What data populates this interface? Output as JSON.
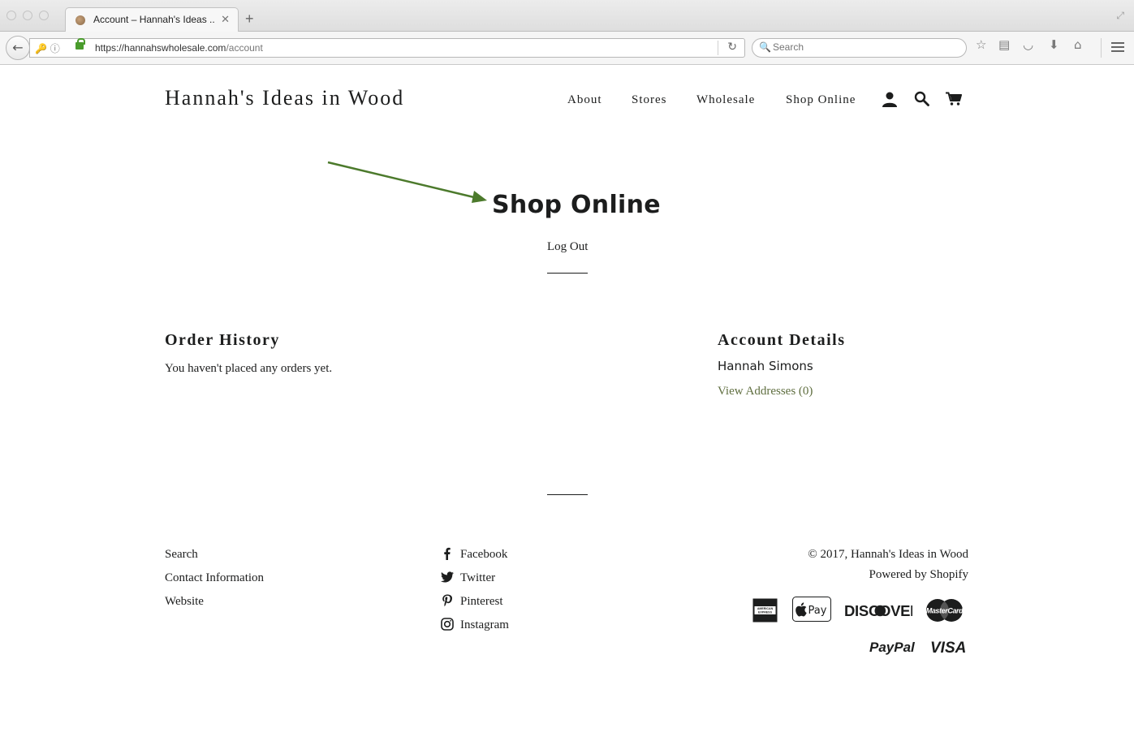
{
  "browser": {
    "tab_title": "Account – Hannah's Ideas in Wood",
    "tab_title_display": "Account – Hannah's Ideas ...",
    "url_host": "https://hannahswholesale.com",
    "url_path": "/account",
    "search_placeholder": "Search"
  },
  "header": {
    "site_title": "Hannah's Ideas in Wood",
    "nav": [
      "About",
      "Stores",
      "Wholesale",
      "Shop Online"
    ]
  },
  "annotation": {
    "arrow_color": "#4c7a2c"
  },
  "main": {
    "heading": "Shop Online",
    "logout": "Log Out",
    "order_history": {
      "title": "Order History",
      "empty_message": "You haven't placed any orders yet."
    },
    "account_details": {
      "title": "Account Details",
      "name": "Hannah Simons",
      "addresses_link": "View Addresses (0)"
    }
  },
  "footer": {
    "links": [
      "Search",
      "Contact Information",
      "Website"
    ],
    "social": [
      {
        "label": "Facebook",
        "icon": "facebook-icon"
      },
      {
        "label": "Twitter",
        "icon": "twitter-icon"
      },
      {
        "label": "Pinterest",
        "icon": "pinterest-icon"
      },
      {
        "label": "Instagram",
        "icon": "instagram-icon"
      }
    ],
    "copyright": "© 2017, Hannah's Ideas in Wood",
    "powered_by": "Powered by Shopify",
    "payment": {
      "amex": "AMERICAN EXPRESS",
      "apple_pay": "Pay",
      "discover": "DISCOVER",
      "mastercard": "MasterCard",
      "paypal": "PayPal",
      "visa": "VISA"
    }
  },
  "colors": {
    "text": "#1c1d1d",
    "link_accent": "#5f6e3f"
  }
}
